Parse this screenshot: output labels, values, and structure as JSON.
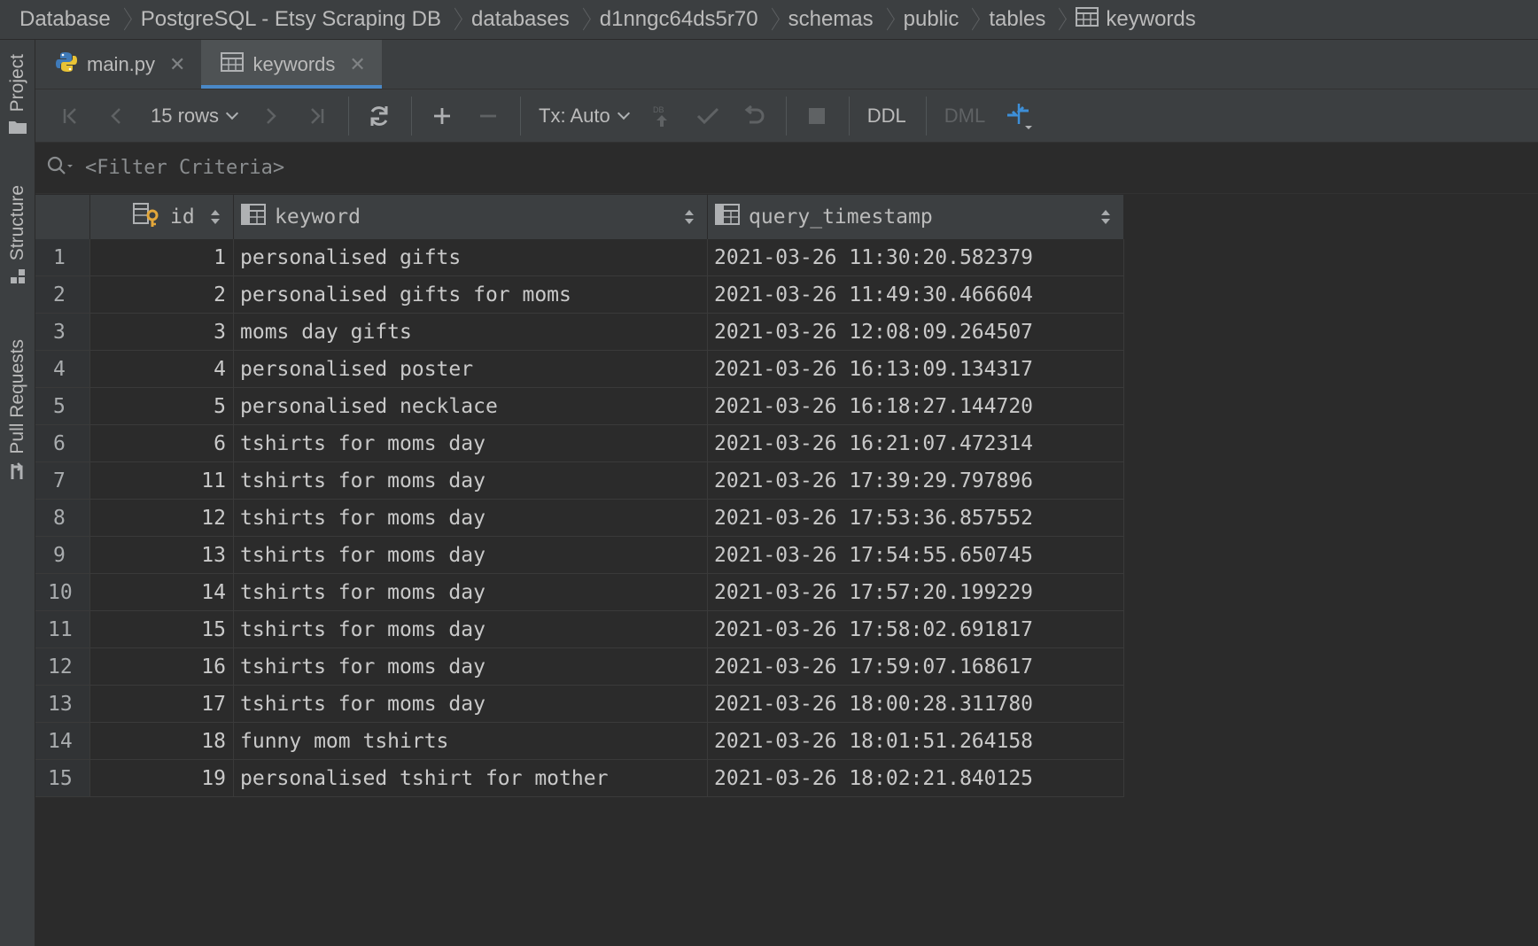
{
  "breadcrumb": [
    "Database",
    "PostgreSQL - Etsy Scraping DB",
    "databases",
    "d1nngc64ds5r70",
    "schemas",
    "public",
    "tables",
    "keywords"
  ],
  "toolstrip": {
    "project": "Project",
    "structure": "Structure",
    "pull_requests": "Pull Requests"
  },
  "tabs": [
    {
      "label": "main.py",
      "active": false
    },
    {
      "label": "keywords",
      "active": true
    }
  ],
  "toolbar": {
    "rows_label": "15 rows",
    "tx_label": "Tx: Auto",
    "ddl": "DDL",
    "dml": "DML"
  },
  "filter": {
    "placeholder": "<Filter Criteria>"
  },
  "grid": {
    "columns": [
      "id",
      "keyword",
      "query_timestamp"
    ],
    "rows": [
      {
        "n": "1",
        "id": "1",
        "keyword": "personalised gifts",
        "ts": "2021-03-26 11:30:20.582379"
      },
      {
        "n": "2",
        "id": "2",
        "keyword": "personalised gifts for moms",
        "ts": "2021-03-26 11:49:30.466604"
      },
      {
        "n": "3",
        "id": "3",
        "keyword": "moms day gifts",
        "ts": "2021-03-26 12:08:09.264507"
      },
      {
        "n": "4",
        "id": "4",
        "keyword": "personalised poster",
        "ts": "2021-03-26 16:13:09.134317"
      },
      {
        "n": "5",
        "id": "5",
        "keyword": "personalised necklace",
        "ts": "2021-03-26 16:18:27.144720"
      },
      {
        "n": "6",
        "id": "6",
        "keyword": "tshirts for moms day",
        "ts": "2021-03-26 16:21:07.472314"
      },
      {
        "n": "7",
        "id": "11",
        "keyword": "tshirts for moms day",
        "ts": "2021-03-26 17:39:29.797896"
      },
      {
        "n": "8",
        "id": "12",
        "keyword": "tshirts for moms day",
        "ts": "2021-03-26 17:53:36.857552"
      },
      {
        "n": "9",
        "id": "13",
        "keyword": "tshirts for moms day",
        "ts": "2021-03-26 17:54:55.650745"
      },
      {
        "n": "10",
        "id": "14",
        "keyword": "tshirts for moms day",
        "ts": "2021-03-26 17:57:20.199229"
      },
      {
        "n": "11",
        "id": "15",
        "keyword": "tshirts for moms day",
        "ts": "2021-03-26 17:58:02.691817"
      },
      {
        "n": "12",
        "id": "16",
        "keyword": "tshirts for moms day",
        "ts": "2021-03-26 17:59:07.168617"
      },
      {
        "n": "13",
        "id": "17",
        "keyword": "tshirts for moms day",
        "ts": "2021-03-26 18:00:28.311780"
      },
      {
        "n": "14",
        "id": "18",
        "keyword": "funny mom tshirts",
        "ts": "2021-03-26 18:01:51.264158"
      },
      {
        "n": "15",
        "id": "19",
        "keyword": "personalised tshirt for mother",
        "ts": "2021-03-26 18:02:21.840125"
      }
    ]
  }
}
